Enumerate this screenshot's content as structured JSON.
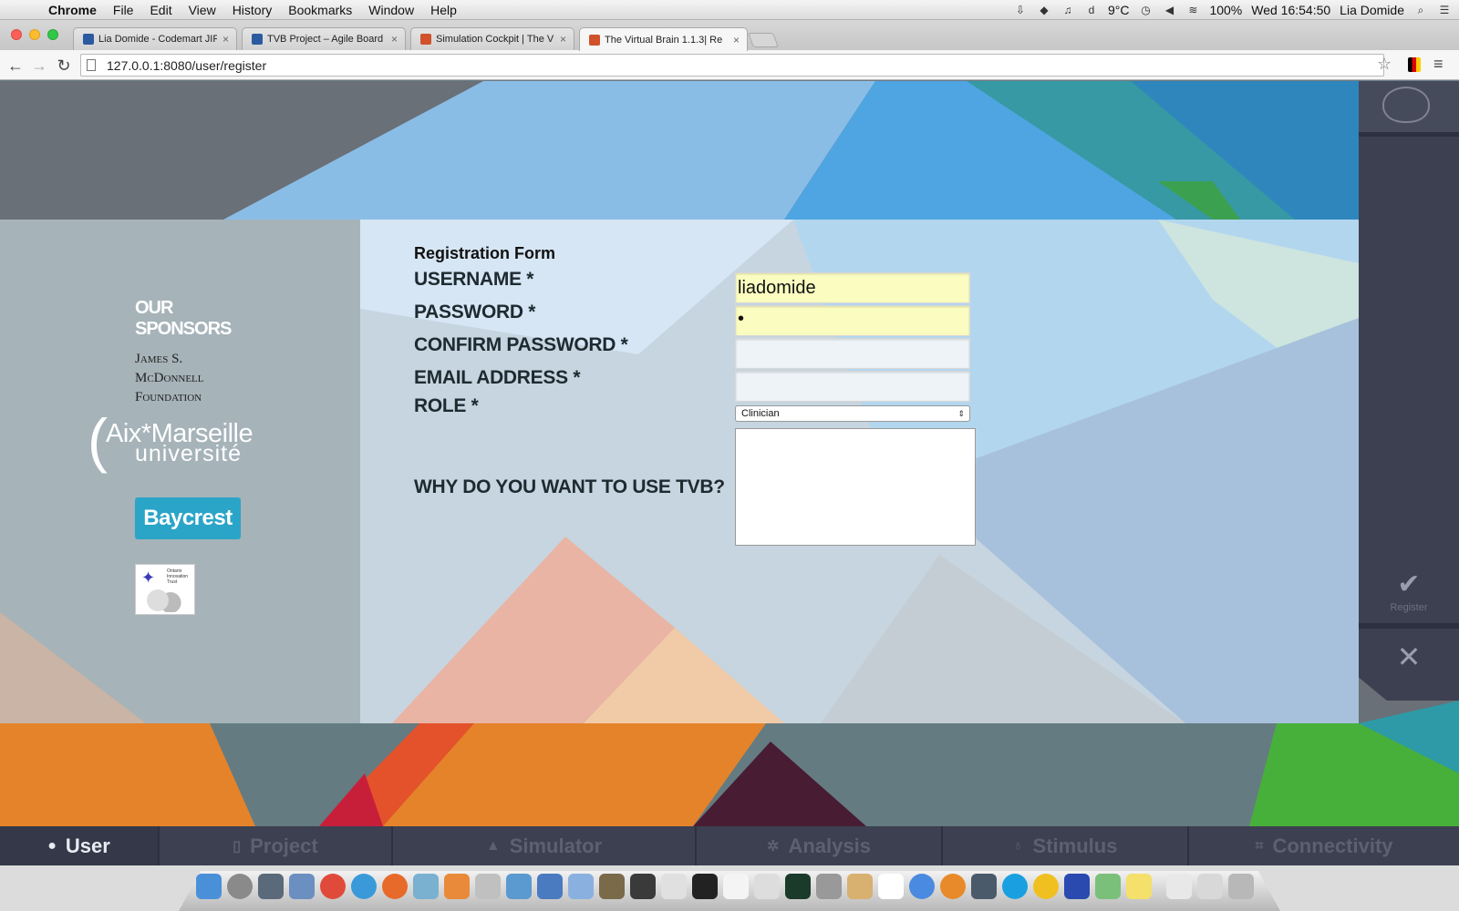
{
  "menubar": {
    "app": "Chrome",
    "items": [
      "File",
      "Edit",
      "View",
      "History",
      "Bookmarks",
      "Window",
      "Help"
    ],
    "weather": "9°C",
    "battery": "100%",
    "clock": "Wed 16:54:50",
    "user": "Lia Domide"
  },
  "browser": {
    "tabs": [
      {
        "title": "Lia Domide - Codemart JIR",
        "favicon_color": "#2c5aa0"
      },
      {
        "title": "TVB Project – Agile Board",
        "favicon_color": "#2c5aa0"
      },
      {
        "title": "Simulation Cockpit | The V",
        "favicon_color": "#d0512a"
      },
      {
        "title": "The Virtual Brain 1.1.3| Re",
        "favicon_color": "#d0512a"
      }
    ],
    "url": "127.0.0.1:8080/user/register"
  },
  "sponsors": {
    "title": "OUR SPONSORS",
    "mcdonnell": "James S. McDonnell Foundation",
    "aix_line1": "Aix*Marseille",
    "aix_line2": "université",
    "baycrest": "Baycrest",
    "oit": "Ontario Innovation Trust"
  },
  "form": {
    "title": "Registration Form",
    "username_label": "USERNAME *",
    "username_value": "liadomide",
    "password_label": "PASSWORD *",
    "password_value": "•",
    "confirm_label": "CONFIRM PASSWORD *",
    "email_label": "EMAIL ADDRESS *",
    "role_label": "ROLE *",
    "role_value": "Clinician",
    "why_label": "WHY DO YOU WANT TO USE TVB?"
  },
  "sidebar": {
    "register_label": "Register"
  },
  "bottomnav": [
    {
      "label": "User",
      "icon": "user-icon",
      "active": true
    },
    {
      "label": "Project",
      "icon": "document-icon",
      "active": false
    },
    {
      "label": "Simulator",
      "icon": "rocket-icon",
      "active": false
    },
    {
      "label": "Analysis",
      "icon": "gear-icon",
      "active": false
    },
    {
      "label": "Stimulus",
      "icon": "pin-icon",
      "active": false
    },
    {
      "label": "Connectivity",
      "icon": "connectivity-icon",
      "active": false
    }
  ],
  "colors": {
    "accent_orange": "#e5832a",
    "nav_dark": "#3c4051",
    "autofill": "#fafcc0"
  }
}
